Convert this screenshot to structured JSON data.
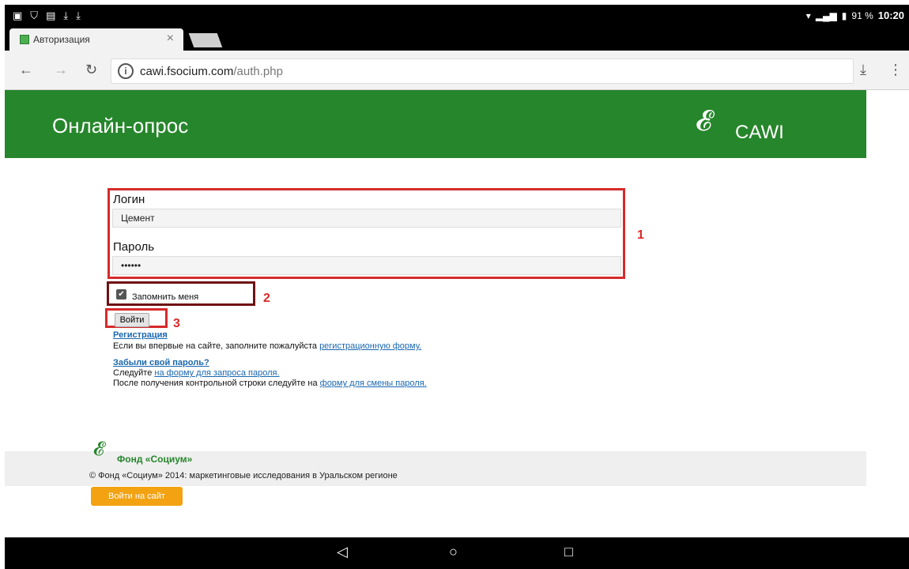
{
  "status_bar": {
    "battery": "91 %",
    "time": "10:20"
  },
  "browser": {
    "tab_title": "Авторизация",
    "url_host": "cawi.fsocium.com",
    "url_path": "/auth.php"
  },
  "header": {
    "title": "Онлайн-опрос",
    "logo_text": "CAWI"
  },
  "form": {
    "login_label": "Логин",
    "login_value": "Цемент",
    "password_label": "Пароль",
    "password_value": "••••••",
    "remember_label": "Запомнить меня",
    "submit_label": "Войти"
  },
  "annotations": {
    "n1": "1",
    "n2": "2",
    "n3": "3"
  },
  "links": {
    "registration_title": "Регистрация",
    "registration_text": "Если вы впервые на сайте, заполните пожалуйста",
    "registration_link": "регистрационную форму.",
    "forgot_title": "Забыли свой пароль?",
    "forgot_text": "Следуйте",
    "forgot_link": "на форму для запроса пароля.",
    "after_text": "После получения контрольной строки следуйте на",
    "after_link": "форму для смены пароля."
  },
  "footer": {
    "org_name": "Фонд «Социум»",
    "copyright": "© Фонд «Социум» 2014: маркетинговые исследования в Уральском регионе",
    "enter_button": "Войти на сайт"
  },
  "colors": {
    "brand_green": "#26862b",
    "annotation_red": "#d62b2b",
    "enter_button_orange": "#f3a212"
  }
}
